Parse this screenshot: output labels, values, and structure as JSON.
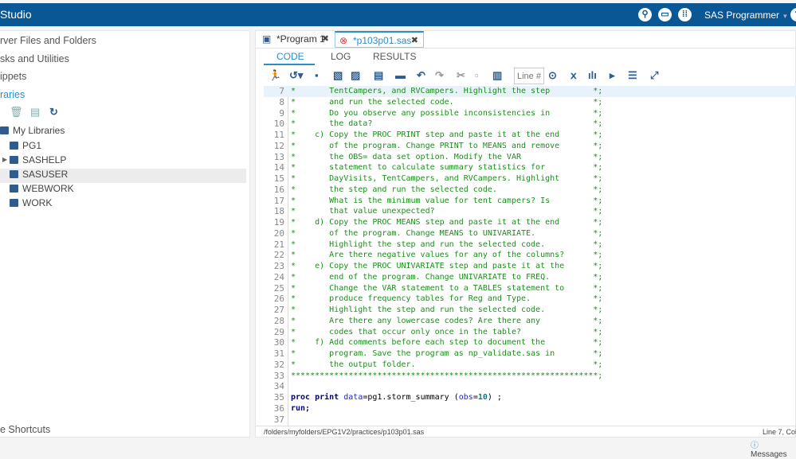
{
  "app": {
    "title": "Studio",
    "user": "SAS Programmer",
    "icons": [
      "search-icon",
      "folder-icon",
      "apps-grid-icon",
      "help-icon"
    ]
  },
  "sidebar": {
    "sections": [
      "rver Files and Folders",
      "sks and Utilities",
      "ippets",
      "raries"
    ],
    "tree_root": "My Libraries",
    "libraries": [
      "PG1",
      "SASHELP",
      "SASUSER",
      "WEBWORK",
      "WORK"
    ],
    "footer": "e Shortcuts"
  },
  "tabs": [
    {
      "label": "*Program 1"
    },
    {
      "label": "*p103p01.sas"
    }
  ],
  "subtabs": [
    "CODE",
    "LOG",
    "RESULTS"
  ],
  "toolbar": {
    "line_placeholder": "Line #"
  },
  "code": [
    {
      "n": "7",
      "text": "*       TentCampers, and RVCampers. Highlight the step",
      "end": "*;"
    },
    {
      "n": "8",
      "text": "*       and run the selected code.",
      "end": "*;"
    },
    {
      "n": "9",
      "text": "*       Do you observe any possible inconsistencies in",
      "end": "*;"
    },
    {
      "n": "10",
      "text": "*       the data?",
      "end": "*;"
    },
    {
      "n": "11",
      "text": "*    c) Copy the PROC PRINT step and paste it at the end",
      "end": "*;"
    },
    {
      "n": "12",
      "text": "*       of the program. Change PRINT to MEANS and remove",
      "end": "*;"
    },
    {
      "n": "13",
      "text": "*       the OBS= data set option. Modify the VAR",
      "end": "*;"
    },
    {
      "n": "14",
      "text": "*       statement to calculate summary statistics for",
      "end": "*;"
    },
    {
      "n": "15",
      "text": "*       DayVisits, TentCampers, and RVCampers. Highlight",
      "end": "*;"
    },
    {
      "n": "16",
      "text": "*       the step and run the selected code.",
      "end": "*;"
    },
    {
      "n": "17",
      "text": "*       What is the minimum value for tent campers? Is",
      "end": "*;"
    },
    {
      "n": "18",
      "text": "*       that value unexpected?",
      "end": "*;"
    },
    {
      "n": "19",
      "text": "*    d) Copy the PROC MEANS step and paste it at the end",
      "end": "*;"
    },
    {
      "n": "20",
      "text": "*       of the program. Change MEANS to UNIVARIATE.",
      "end": "*;"
    },
    {
      "n": "21",
      "text": "*       Highlight the step and run the selected code.",
      "end": "*;"
    },
    {
      "n": "22",
      "text": "*       Are there negative values for any of the columns?",
      "end": "*;"
    },
    {
      "n": "23",
      "text": "*    e) Copy the PROC UNIVARIATE step and paste it at the",
      "end": "*;"
    },
    {
      "n": "24",
      "text": "*       end of the program. Change UNIVARIATE to FREQ.",
      "end": "*;"
    },
    {
      "n": "25",
      "text": "*       Change the VAR statement to a TABLES statement to",
      "end": "*;"
    },
    {
      "n": "26",
      "text": "*       produce frequency tables for Reg and Type.",
      "end": "*;"
    },
    {
      "n": "27",
      "text": "*       Highlight the step and run the selected code.",
      "end": "*;"
    },
    {
      "n": "28",
      "text": "*       Are there any lowercase codes? Are there any",
      "end": "*;"
    },
    {
      "n": "29",
      "text": "*       codes that occur only once in the table?",
      "end": "*;"
    },
    {
      "n": "30",
      "text": "*    f) Add comments before each step to document the",
      "end": "*;"
    },
    {
      "n": "31",
      "text": "*       program. Save the program as np_validate.sas in",
      "end": "*;"
    },
    {
      "n": "32",
      "text": "*       the output folder.",
      "end": "*;"
    },
    {
      "n": "33",
      "text": "***************************************************************",
      "end": "*;"
    },
    {
      "n": "34",
      "text": "",
      "end": ""
    }
  ],
  "code_tail": [
    {
      "n": "35",
      "tokens": [
        {
          "t": "proc print ",
          "c": "kw"
        },
        {
          "t": "data",
          "c": "ar"
        },
        {
          "t": "=pg1.storm_summary (",
          "c": "pl"
        },
        {
          "t": "obs",
          "c": "ar"
        },
        {
          "t": "=",
          "c": "pl"
        },
        {
          "t": "10",
          "c": "nm"
        },
        {
          "t": ") ;",
          "c": "pl"
        }
      ]
    },
    {
      "n": "36",
      "tokens": [
        {
          "t": "run;",
          "c": "kw"
        }
      ]
    },
    {
      "n": "37",
      "tokens": []
    }
  ],
  "status": {
    "path": "/folders/myfolders/EPG1V2/practices/p103p01.sas",
    "position": "Line 7, Col"
  },
  "messages": "Messages"
}
